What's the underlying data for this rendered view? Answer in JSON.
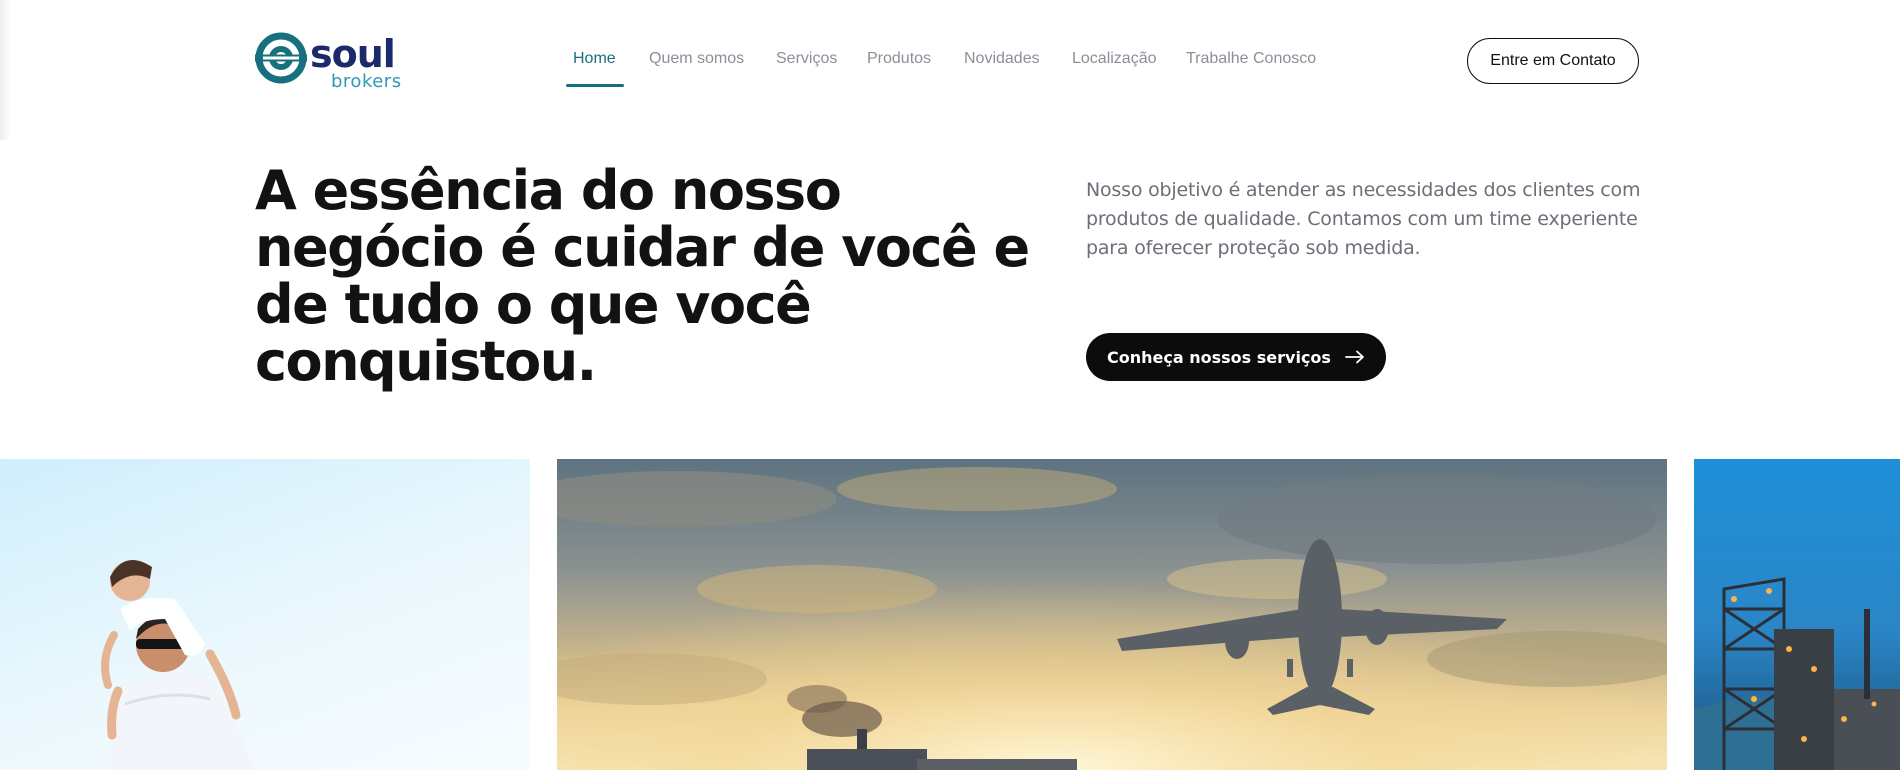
{
  "brand": {
    "name_main": "soul",
    "name_sub": "brokers",
    "colors": {
      "navy": "#1b2a6b",
      "teal": "#16707d",
      "light_teal": "#2c9bb2"
    }
  },
  "nav": {
    "items": [
      {
        "label": "Home",
        "active": true
      },
      {
        "label": "Quem somos",
        "active": false
      },
      {
        "label": "Serviços",
        "active": false
      },
      {
        "label": "Produtos",
        "active": false
      },
      {
        "label": "Novidades",
        "active": false
      },
      {
        "label": "Localização",
        "active": false
      },
      {
        "label": "Trabalhe Conosco",
        "active": false
      }
    ],
    "contact_button": "Entre em Contato"
  },
  "hero": {
    "headline": "A essência do nosso negócio é cuidar de você e de tudo o que você conquistou.",
    "intro": "Nosso objetivo é atender as necessidades dos clientes com produtos de qualidade. Contamos com um time experiente para oferecer proteção sob medida.",
    "cta_label": "Conheça nossos serviços",
    "cta_icon": "arrow-right-icon"
  },
  "gallery": {
    "images": [
      {
        "subject": "father-with-daughter-on-shoulders-photo"
      },
      {
        "subject": "airplane-over-ship-at-sunset-photo"
      },
      {
        "subject": "industrial-plant-at-night-photo"
      }
    ]
  }
}
